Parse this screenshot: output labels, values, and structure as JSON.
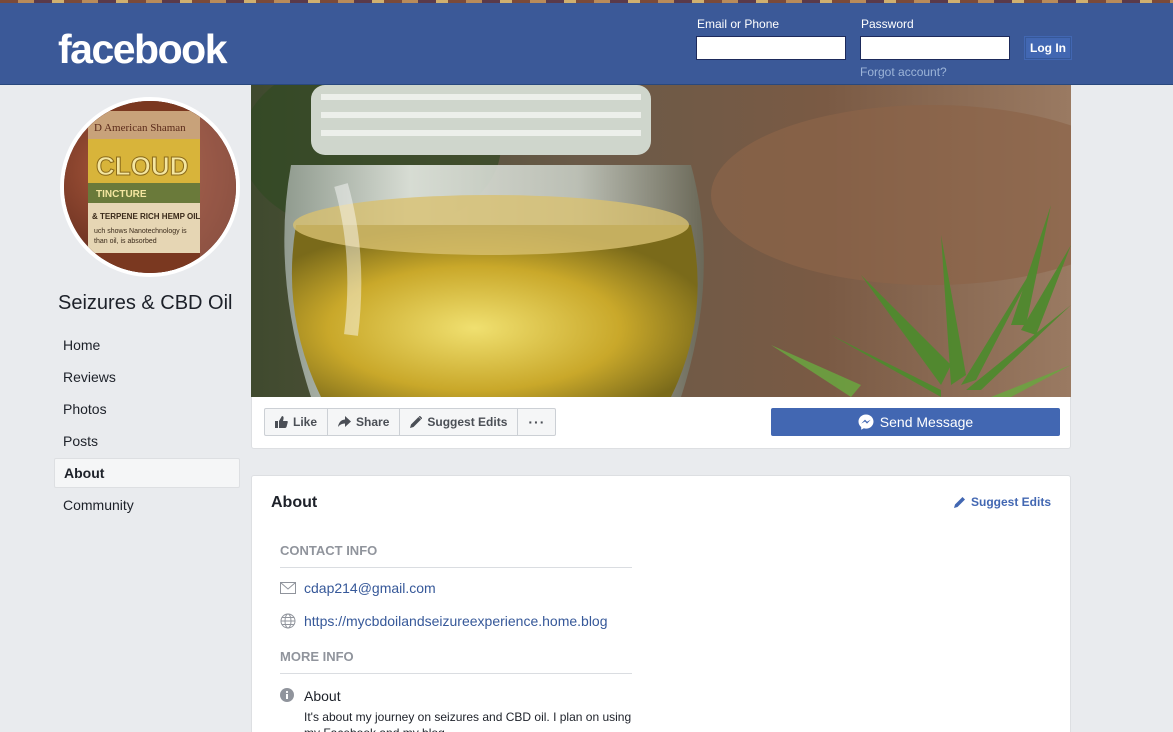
{
  "header": {
    "logo": "facebook",
    "email_label": "Email or Phone",
    "password_label": "Password",
    "login_button": "Log In",
    "forgot_link": "Forgot account?"
  },
  "page": {
    "name": "Seizures & CBD Oil"
  },
  "sidebar": {
    "items": [
      {
        "label": "Home"
      },
      {
        "label": "Reviews"
      },
      {
        "label": "Photos"
      },
      {
        "label": "Posts"
      },
      {
        "label": "About"
      },
      {
        "label": "Community"
      }
    ],
    "active_item": "About"
  },
  "actions": {
    "like": "Like",
    "share": "Share",
    "suggest_edits": "Suggest Edits",
    "more": "···",
    "send_message": "Send Message"
  },
  "about": {
    "title": "About",
    "suggest_edits": "Suggest Edits",
    "contact_heading": "CONTACT INFO",
    "email": "cdap214@gmail.com",
    "website": "https://mycbdoilandseizureexperience.home.blog",
    "more_heading": "MORE INFO",
    "about_label": "About",
    "about_text": "It's about my journey on seizures and CBD oil. I plan on using my Facebook and my blog"
  },
  "icons": {
    "like": "thumbs-up-icon",
    "share": "share-arrow-icon",
    "edit": "pencil-icon",
    "messenger": "messenger-icon",
    "email": "envelope-icon",
    "website": "globe-icon",
    "info": "info-icon"
  },
  "colors": {
    "brand": "#3b5998",
    "button": "#4267b2",
    "link": "#365899",
    "page_bg": "#e9ebee"
  }
}
